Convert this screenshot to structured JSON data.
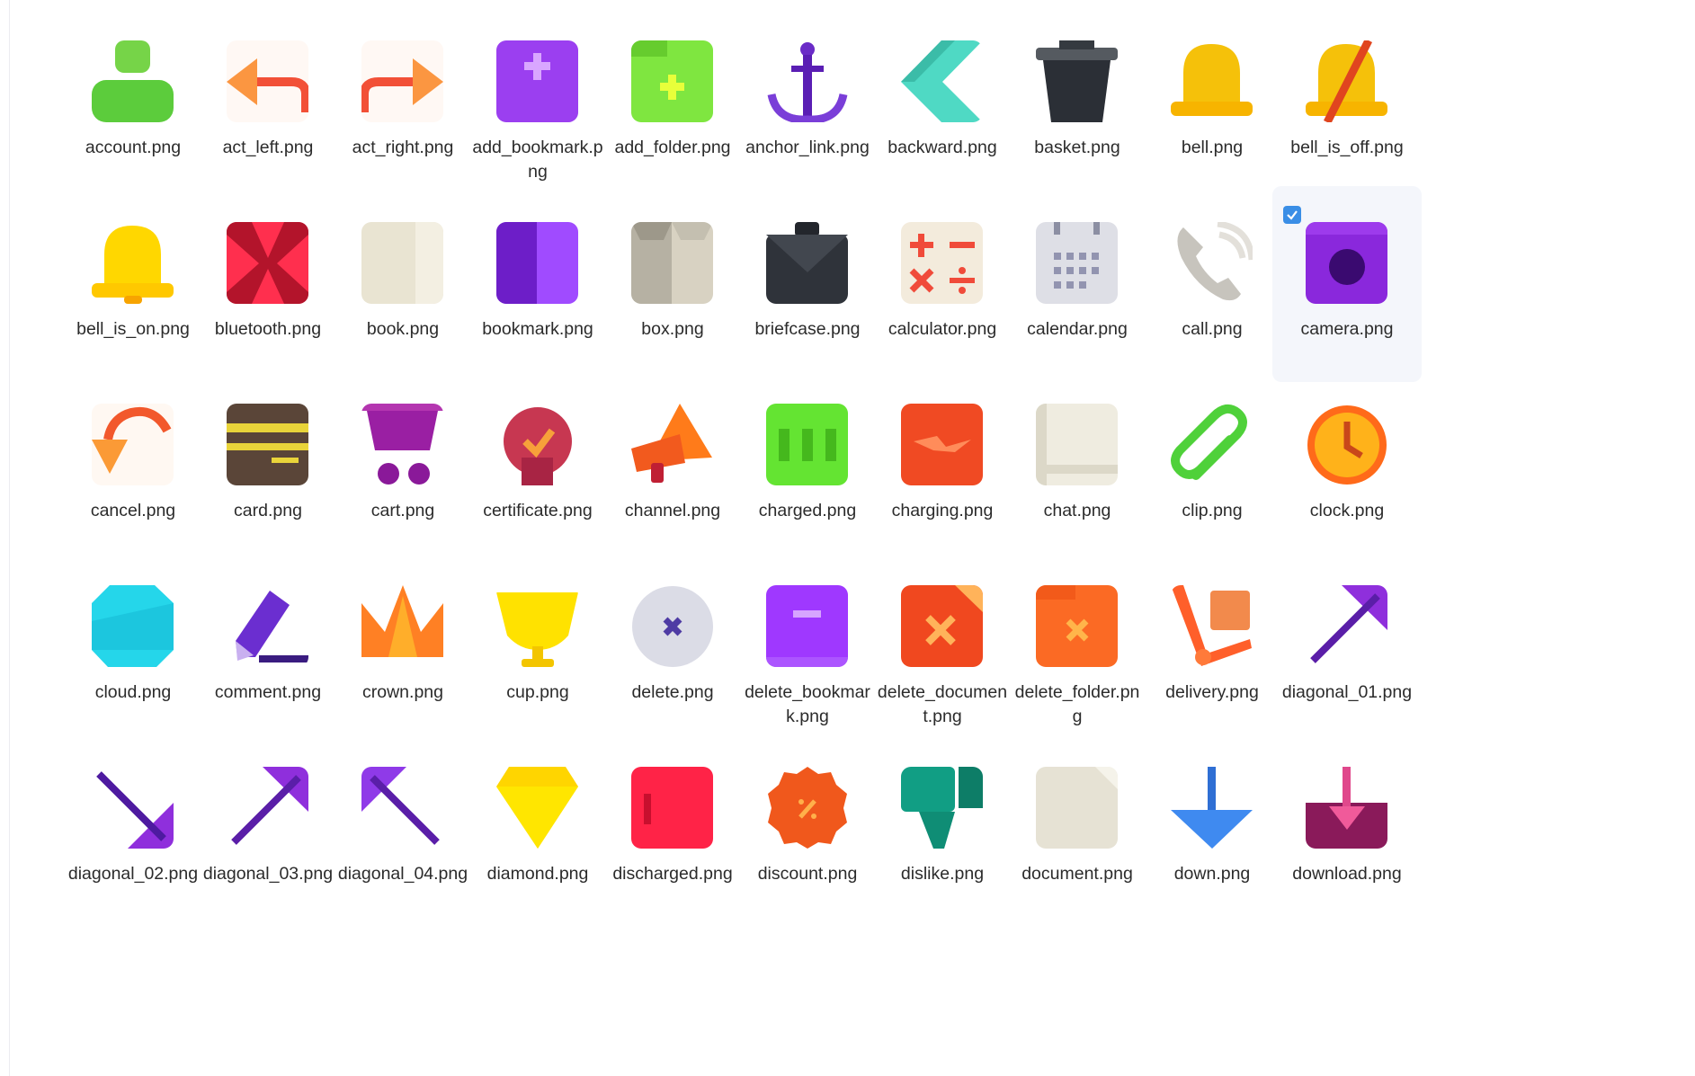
{
  "files": [
    {
      "name": "account.png",
      "icon": "account-icon"
    },
    {
      "name": "act_left.png",
      "icon": "act-left-icon"
    },
    {
      "name": "act_right.png",
      "icon": "act-right-icon"
    },
    {
      "name": "add_bookmark.png",
      "icon": "add-bookmark-icon"
    },
    {
      "name": "add_folder.png",
      "icon": "add-folder-icon"
    },
    {
      "name": "anchor_link.png",
      "icon": "anchor-icon"
    },
    {
      "name": "backward.png",
      "icon": "backward-icon"
    },
    {
      "name": "basket.png",
      "icon": "basket-icon"
    },
    {
      "name": "bell.png",
      "icon": "bell-icon"
    },
    {
      "name": "bell_is_off.png",
      "icon": "bell-off-icon"
    },
    {
      "name": "bell_is_on.png",
      "icon": "bell-on-icon"
    },
    {
      "name": "bluetooth.png",
      "icon": "bluetooth-icon"
    },
    {
      "name": "book.png",
      "icon": "book-icon"
    },
    {
      "name": "bookmark.png",
      "icon": "bookmark-icon"
    },
    {
      "name": "box.png",
      "icon": "box-icon"
    },
    {
      "name": "briefcase.png",
      "icon": "briefcase-icon"
    },
    {
      "name": "calculator.png",
      "icon": "calculator-icon"
    },
    {
      "name": "calendar.png",
      "icon": "calendar-icon"
    },
    {
      "name": "call.png",
      "icon": "call-icon"
    },
    {
      "name": "camera.png",
      "icon": "camera-icon",
      "selected": true
    },
    {
      "name": "cancel.png",
      "icon": "cancel-icon"
    },
    {
      "name": "card.png",
      "icon": "card-icon"
    },
    {
      "name": "cart.png",
      "icon": "cart-icon"
    },
    {
      "name": "certificate.png",
      "icon": "certificate-icon"
    },
    {
      "name": "channel.png",
      "icon": "megaphone-icon"
    },
    {
      "name": "charged.png",
      "icon": "battery-charged-icon"
    },
    {
      "name": "charging.png",
      "icon": "battery-charging-icon"
    },
    {
      "name": "chat.png",
      "icon": "chat-icon"
    },
    {
      "name": "clip.png",
      "icon": "clip-icon"
    },
    {
      "name": "clock.png",
      "icon": "clock-icon"
    },
    {
      "name": "cloud.png",
      "icon": "cloud-icon"
    },
    {
      "name": "comment.png",
      "icon": "comment-icon"
    },
    {
      "name": "crown.png",
      "icon": "crown-icon"
    },
    {
      "name": "cup.png",
      "icon": "cup-icon"
    },
    {
      "name": "delete.png",
      "icon": "delete-icon"
    },
    {
      "name": "delete_bookmark.png",
      "icon": "delete-bookmark-icon"
    },
    {
      "name": "delete_document.png",
      "icon": "delete-document-icon"
    },
    {
      "name": "delete_folder.png",
      "icon": "delete-folder-icon"
    },
    {
      "name": "delivery.png",
      "icon": "delivery-icon"
    },
    {
      "name": "diagonal_01.png",
      "icon": "arrow-down-left-icon"
    },
    {
      "name": "diagonal_02.png",
      "icon": "arrow-down-right-icon"
    },
    {
      "name": "diagonal_03.png",
      "icon": "arrow-down-left-icon"
    },
    {
      "name": "diagonal_04.png",
      "icon": "arrow-up-left-icon"
    },
    {
      "name": "diamond.png",
      "icon": "diamond-icon"
    },
    {
      "name": "discharged.png",
      "icon": "battery-discharged-icon"
    },
    {
      "name": "discount.png",
      "icon": "discount-icon"
    },
    {
      "name": "dislike.png",
      "icon": "dislike-icon"
    },
    {
      "name": "document.png",
      "icon": "document-icon"
    },
    {
      "name": "down.png",
      "icon": "arrow-down-icon"
    },
    {
      "name": "download.png",
      "icon": "download-icon"
    }
  ],
  "colors": {
    "selection_bg": "#f4f6fb",
    "checkbox": "#3a8ee6",
    "label_text": "#2b2b2b"
  }
}
